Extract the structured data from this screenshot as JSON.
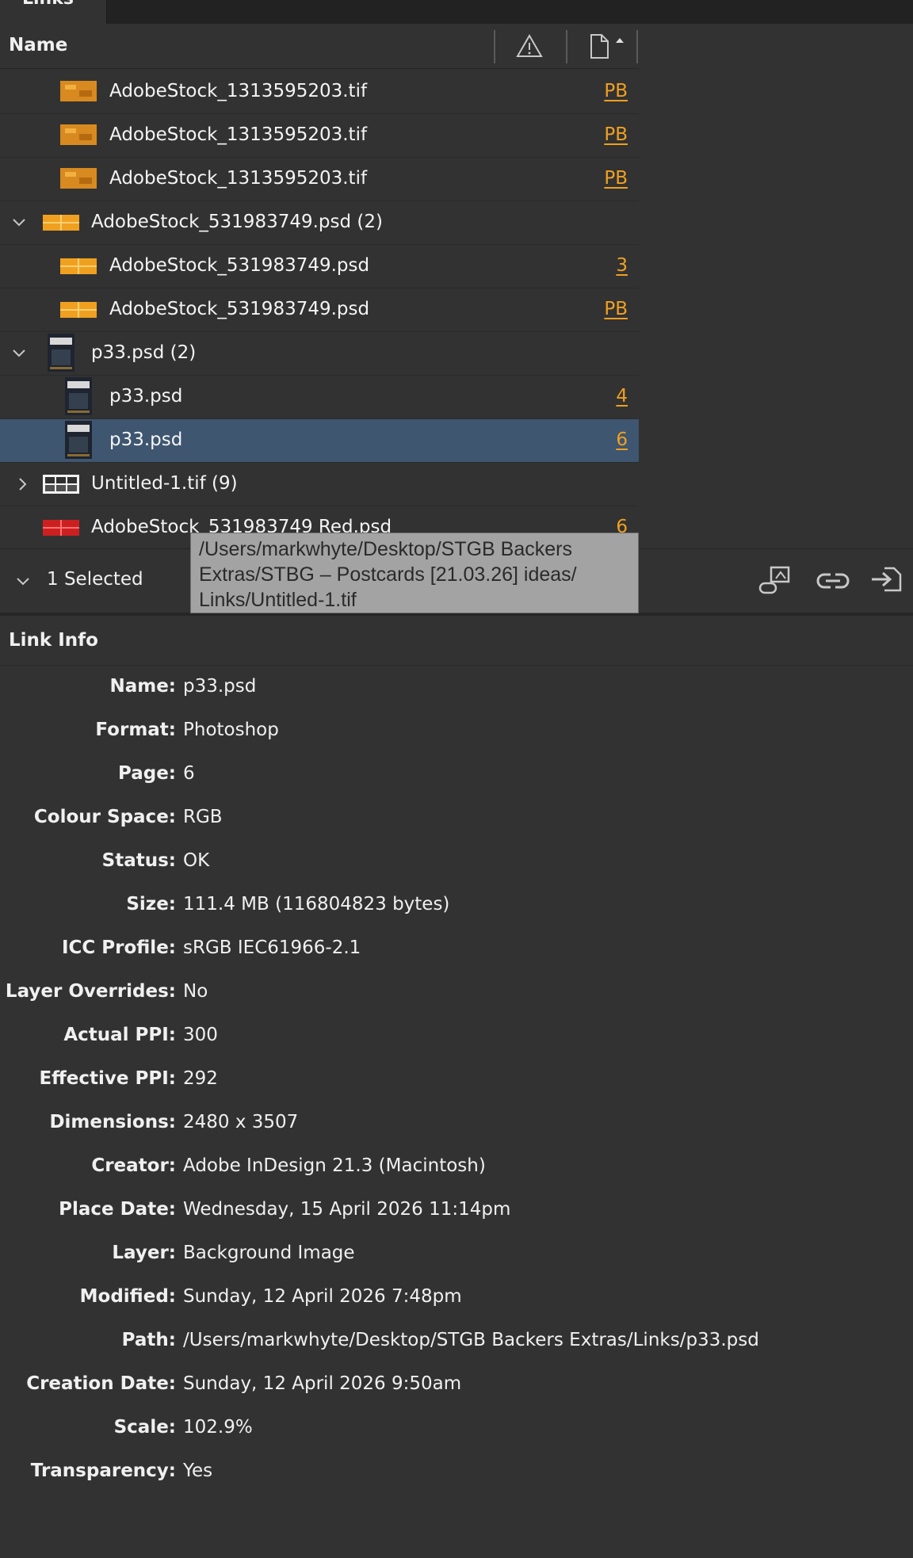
{
  "panel": {
    "tab_title": "Links"
  },
  "header": {
    "name_label": "Name"
  },
  "rows": [
    {
      "label": "AdobeStock_1313595203.tif",
      "page": "PB"
    },
    {
      "label": "AdobeStock_1313595203.tif",
      "page": "PB"
    },
    {
      "label": "AdobeStock_1313595203.tif",
      "page": "PB"
    },
    {
      "label": "AdobeStock_531983749.psd (2)",
      "page": ""
    },
    {
      "label": "AdobeStock_531983749.psd",
      "page": "3"
    },
    {
      "label": "AdobeStock_531983749.psd",
      "page": "PB"
    },
    {
      "label": "p33.psd (2)",
      "page": ""
    },
    {
      "label": "p33.psd",
      "page": "4"
    },
    {
      "label": "p33.psd",
      "page": "6"
    },
    {
      "label": "Untitled-1.tif (9)",
      "page": ""
    },
    {
      "label": "AdobeStock_531983749 Red.psd",
      "page": "6"
    }
  ],
  "selection": {
    "label": "1 Selected"
  },
  "tooltip": {
    "line1": "/Users/markwhyte/Desktop/STGB Backers",
    "line2": "Extras/STBG – Postcards [21.03.26] ideas/",
    "line3": "Links/Untitled-1.tif"
  },
  "link_info": {
    "title": "Link Info",
    "fields": [
      {
        "key": "Name:",
        "value": "p33.psd"
      },
      {
        "key": "Format:",
        "value": "Photoshop"
      },
      {
        "key": "Page:",
        "value": "6"
      },
      {
        "key": "Colour Space:",
        "value": "RGB"
      },
      {
        "key": "Status:",
        "value": "OK"
      },
      {
        "key": "Size:",
        "value": "111.4 MB (116804823 bytes)"
      },
      {
        "key": "ICC Profile:",
        "value": "sRGB IEC61966-2.1"
      },
      {
        "key": "Layer Overrides:",
        "value": "No"
      },
      {
        "key": "Actual PPI:",
        "value": "300"
      },
      {
        "key": "Effective PPI:",
        "value": "292"
      },
      {
        "key": "Dimensions:",
        "value": "2480 x 3507"
      },
      {
        "key": "Creator:",
        "value": "Adobe InDesign 21.3 (Macintosh)"
      },
      {
        "key": "Place Date:",
        "value": "Wednesday, 15 April 2026 11:14pm"
      },
      {
        "key": "Layer:",
        "value": "Background Image"
      },
      {
        "key": "Modified:",
        "value": "Sunday, 12 April 2026 7:48pm"
      },
      {
        "key": "Path:",
        "value": "/Users/markwhyte/Desktop/STGB Backers Extras/Links/p33.psd"
      },
      {
        "key": "Creation Date:",
        "value": "Sunday, 12 April 2026 9:50am"
      },
      {
        "key": "Scale:",
        "value": "102.9%"
      },
      {
        "key": "Transparency:",
        "value": "Yes"
      }
    ]
  },
  "colors": {
    "panel_bg": "#323232",
    "selection_bg": "#3e5670",
    "page_link": "#f0a020",
    "tooltip_bg": "#a3a3a3"
  }
}
